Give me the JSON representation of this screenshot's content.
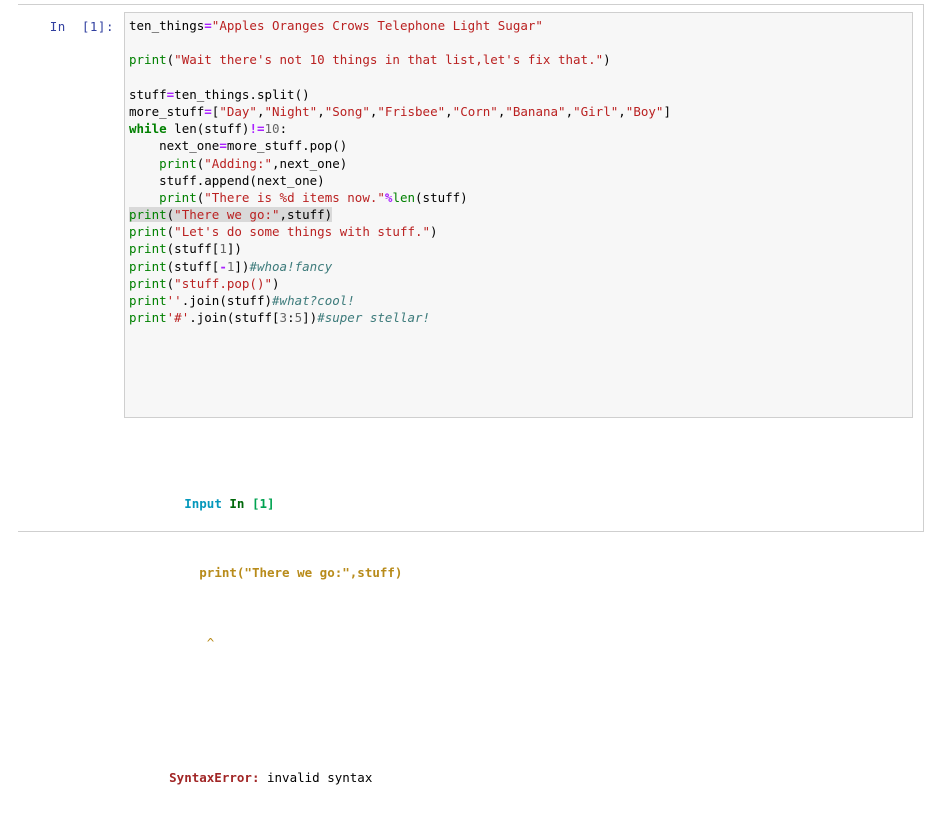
{
  "notebook": {
    "prompt_label": "In  [1]:",
    "cell_execution_count": "[1]"
  },
  "code": {
    "lines": [
      [
        {
          "t": "ten_things",
          "c": "name"
        },
        {
          "t": "=",
          "c": "op"
        },
        {
          "t": "\"Apples Oranges Crows Telephone Light Sugar\"",
          "c": "str"
        }
      ],
      [],
      [
        {
          "t": "print",
          "c": "fn"
        },
        {
          "t": "(",
          "c": "punc"
        },
        {
          "t": "\"Wait there's not 10 things in that list,let's fix that.\"",
          "c": "str"
        },
        {
          "t": ")",
          "c": "punc"
        }
      ],
      [],
      [
        {
          "t": "stuff",
          "c": "name"
        },
        {
          "t": "=",
          "c": "op"
        },
        {
          "t": "ten_things.split()",
          "c": "name"
        }
      ],
      [
        {
          "t": "more_stuff",
          "c": "name"
        },
        {
          "t": "=",
          "c": "op"
        },
        {
          "t": "[",
          "c": "punc"
        },
        {
          "t": "\"Day\"",
          "c": "str"
        },
        {
          "t": ",",
          "c": "punc"
        },
        {
          "t": "\"Night\"",
          "c": "str"
        },
        {
          "t": ",",
          "c": "punc"
        },
        {
          "t": "\"Song\"",
          "c": "str"
        },
        {
          "t": ",",
          "c": "punc"
        },
        {
          "t": "\"Frisbee\"",
          "c": "str"
        },
        {
          "t": ",",
          "c": "punc"
        },
        {
          "t": "\"Corn\"",
          "c": "str"
        },
        {
          "t": ",",
          "c": "punc"
        },
        {
          "t": "\"Banana\"",
          "c": "str"
        },
        {
          "t": ",",
          "c": "punc"
        },
        {
          "t": "\"Girl\"",
          "c": "str"
        },
        {
          "t": ",",
          "c": "punc"
        },
        {
          "t": "\"Boy\"",
          "c": "str"
        },
        {
          "t": "]",
          "c": "punc"
        }
      ],
      [
        {
          "t": "while",
          "c": "kw"
        },
        {
          "t": " ",
          "c": "punc"
        },
        {
          "t": "len",
          "c": "name"
        },
        {
          "t": "(stuff)",
          "c": "punc"
        },
        {
          "t": "!=",
          "c": "op"
        },
        {
          "t": "10",
          "c": "num"
        },
        {
          "t": ":",
          "c": "punc"
        }
      ],
      [
        {
          "t": "    next_one",
          "c": "name"
        },
        {
          "t": "=",
          "c": "op"
        },
        {
          "t": "more_stuff.pop()",
          "c": "name"
        }
      ],
      [
        {
          "t": "    ",
          "c": "punc"
        },
        {
          "t": "print",
          "c": "fn"
        },
        {
          "t": "(",
          "c": "punc"
        },
        {
          "t": "\"Adding:\"",
          "c": "str"
        },
        {
          "t": ",next_one)",
          "c": "punc"
        }
      ],
      [
        {
          "t": "    stuff.append(next_one)",
          "c": "name"
        }
      ],
      [
        {
          "t": "    ",
          "c": "punc"
        },
        {
          "t": "print",
          "c": "fn"
        },
        {
          "t": "(",
          "c": "punc"
        },
        {
          "t": "\"There is %d items now.\"",
          "c": "str"
        },
        {
          "t": "%",
          "c": "strfmt"
        },
        {
          "t": "len",
          "c": "fn"
        },
        {
          "t": "(stuff)",
          "c": "punc"
        }
      ],
      [
        {
          "t": "print",
          "c": "fn",
          "hl": true
        },
        {
          "t": "(",
          "c": "punc",
          "hl": true
        },
        {
          "t": "\"There we go:\"",
          "c": "str",
          "hl": true
        },
        {
          "t": ",stuff)",
          "c": "punc",
          "hl": true
        }
      ],
      [
        {
          "t": "print",
          "c": "fn"
        },
        {
          "t": "(",
          "c": "punc"
        },
        {
          "t": "\"Let's do some things with stuff.\"",
          "c": "str"
        },
        {
          "t": ")",
          "c": "punc"
        }
      ],
      [
        {
          "t": "print",
          "c": "fn"
        },
        {
          "t": "(stuff[",
          "c": "punc"
        },
        {
          "t": "1",
          "c": "num"
        },
        {
          "t": "])",
          "c": "punc"
        }
      ],
      [
        {
          "t": "print",
          "c": "fn"
        },
        {
          "t": "(stuff[",
          "c": "punc"
        },
        {
          "t": "-",
          "c": "op"
        },
        {
          "t": "1",
          "c": "num"
        },
        {
          "t": "])",
          "c": "punc"
        },
        {
          "t": "#whoa!fancy",
          "c": "comment"
        }
      ],
      [
        {
          "t": "print",
          "c": "fn"
        },
        {
          "t": "(",
          "c": "punc"
        },
        {
          "t": "\"stuff.pop()\"",
          "c": "str"
        },
        {
          "t": ")",
          "c": "punc"
        }
      ],
      [
        {
          "t": "print",
          "c": "fn"
        },
        {
          "t": "''",
          "c": "str"
        },
        {
          "t": ".join(stuff)",
          "c": "punc"
        },
        {
          "t": "#what?cool!",
          "c": "comment"
        }
      ],
      [
        {
          "t": "print",
          "c": "fn"
        },
        {
          "t": "'#'",
          "c": "str"
        },
        {
          "t": ".join(stuff[",
          "c": "punc"
        },
        {
          "t": "3",
          "c": "num"
        },
        {
          "t": ":",
          "c": "punc"
        },
        {
          "t": "5",
          "c": "num"
        },
        {
          "t": "])",
          "c": "punc"
        },
        {
          "t": "#super stellar!",
          "c": "comment"
        }
      ]
    ]
  },
  "output": {
    "input_label": "Input",
    "in_label": "In",
    "exec_count": "[1]",
    "echo_line": "print(\"There we go:\",stuff)",
    "caret": "^",
    "error_name": "SyntaxError:",
    "error_message": " invalid syntax"
  },
  "colors": {
    "select_bar": "#42a5f5",
    "code_bg": "#f7f7f7",
    "border": "#cfcfcf",
    "prompt": "#303f9f",
    "string": "#ba2121",
    "keyword": "#008000",
    "operator": "#aa22ff",
    "comment": "#3d7b7b",
    "error": "#a12626",
    "echo": "#b88b1a",
    "highlight_bg": "#d9d9d9"
  }
}
